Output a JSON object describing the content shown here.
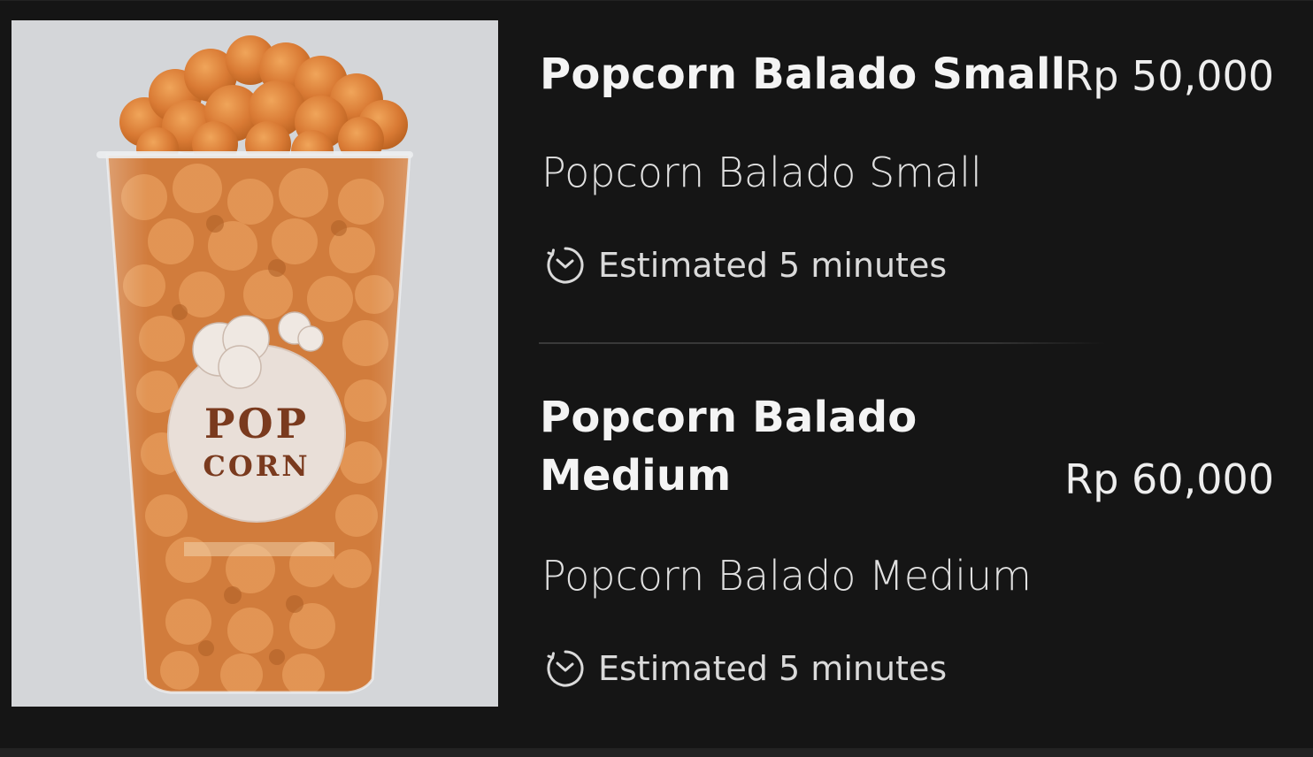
{
  "items": [
    {
      "name": "Popcorn Balado Small",
      "price": "Rp 50,000",
      "description": "Popcorn Balado Small",
      "eta": "Estimated 5 minutes",
      "eta_icon": "clock-icon"
    },
    {
      "name": "Popcorn Balado Medium",
      "price": "Rp 60,000",
      "description": "Popcorn Balado Medium",
      "eta": "Estimated 5 minutes",
      "eta_icon": "clock-icon"
    }
  ],
  "image": {
    "cup_label_line1": "POP",
    "cup_label_line2": "CORN"
  },
  "colors": {
    "background": "#151515",
    "text": "#f4f4f4",
    "divider": "#3a3a3a",
    "image_background": "#d4d6d9",
    "popcorn": "#d9803a"
  }
}
